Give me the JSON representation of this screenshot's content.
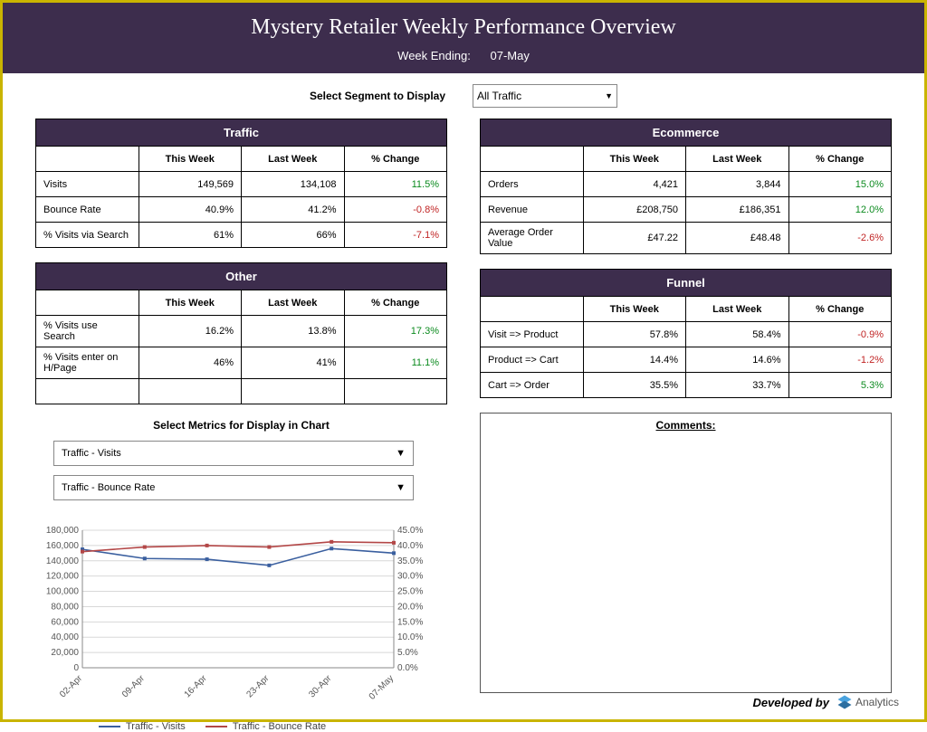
{
  "header": {
    "title": "Mystery Retailer Weekly Performance Overview",
    "week_label": "Week Ending:",
    "week_value": "07-May"
  },
  "segment": {
    "label": "Select Segment to Display",
    "value": "All Traffic"
  },
  "tables": {
    "traffic": {
      "title": "Traffic",
      "cols": [
        "This Week",
        "Last Week",
        "% Change"
      ],
      "rows": [
        {
          "label": "Visits",
          "tw": "149,569",
          "lw": "134,108",
          "chg": "11.5%",
          "dir": "pos"
        },
        {
          "label": "Bounce Rate",
          "tw": "40.9%",
          "lw": "41.2%",
          "chg": "-0.8%",
          "dir": "neg"
        },
        {
          "label": "% Visits via Search",
          "tw": "61%",
          "lw": "66%",
          "chg": "-7.1%",
          "dir": "neg"
        }
      ]
    },
    "ecommerce": {
      "title": "Ecommerce",
      "cols": [
        "This Week",
        "Last Week",
        "% Change"
      ],
      "rows": [
        {
          "label": "Orders",
          "tw": "4,421",
          "lw": "3,844",
          "chg": "15.0%",
          "dir": "pos"
        },
        {
          "label": "Revenue",
          "tw": "£208,750",
          "lw": "£186,351",
          "chg": "12.0%",
          "dir": "pos"
        },
        {
          "label": "Average Order Value",
          "tw": "£47.22",
          "lw": "£48.48",
          "chg": "-2.6%",
          "dir": "neg"
        }
      ]
    },
    "other": {
      "title": "Other",
      "cols": [
        "This Week",
        "Last Week",
        "% Change"
      ],
      "rows": [
        {
          "label": "% Visits use Search",
          "tw": "16.2%",
          "lw": "13.8%",
          "chg": "17.3%",
          "dir": "pos"
        },
        {
          "label": "% Visits enter on H/Page",
          "tw": "46%",
          "lw": "41%",
          "chg": "11.1%",
          "dir": "pos"
        },
        {
          "label": "",
          "tw": "",
          "lw": "",
          "chg": "",
          "dir": ""
        }
      ]
    },
    "funnel": {
      "title": "Funnel",
      "cols": [
        "This Week",
        "Last Week",
        "% Change"
      ],
      "rows": [
        {
          "label": "Visit => Product",
          "tw": "57.8%",
          "lw": "58.4%",
          "chg": "-0.9%",
          "dir": "neg"
        },
        {
          "label": "Product => Cart",
          "tw": "14.4%",
          "lw": "14.6%",
          "chg": "-1.2%",
          "dir": "neg"
        },
        {
          "label": "Cart => Order",
          "tw": "35.5%",
          "lw": "33.7%",
          "chg": "5.3%",
          "dir": "pos"
        }
      ]
    }
  },
  "chart_select": {
    "title": "Select Metrics for Display in Chart",
    "metric1": "Traffic - Visits",
    "metric2": "Traffic - Bounce Rate"
  },
  "chart_data": {
    "type": "line",
    "categories": [
      "02-Apr",
      "09-Apr",
      "16-Apr",
      "23-Apr",
      "30-Apr",
      "07-May"
    ],
    "series": [
      {
        "name": "Traffic - Visits",
        "axis": "left",
        "values": [
          155000,
          143000,
          142000,
          134000,
          156000,
          150000
        ]
      },
      {
        "name": "Traffic - Bounce Rate",
        "axis": "right",
        "values": [
          0.38,
          0.395,
          0.4,
          0.395,
          0.412,
          0.409
        ]
      }
    ],
    "ylim_left": [
      0,
      180000
    ],
    "yticks_left": [
      0,
      20000,
      40000,
      60000,
      80000,
      100000,
      120000,
      140000,
      160000,
      180000
    ],
    "ylim_right": [
      0,
      0.45
    ],
    "yticks_right": [
      0.0,
      0.05,
      0.1,
      0.15,
      0.2,
      0.25,
      0.3,
      0.35,
      0.4,
      0.45
    ],
    "legend": [
      "Traffic - Visits",
      "Traffic - Bounce Rate"
    ]
  },
  "comments": {
    "title": "Comments:"
  },
  "footer": {
    "text": "Developed by",
    "brand": "Analytics"
  }
}
